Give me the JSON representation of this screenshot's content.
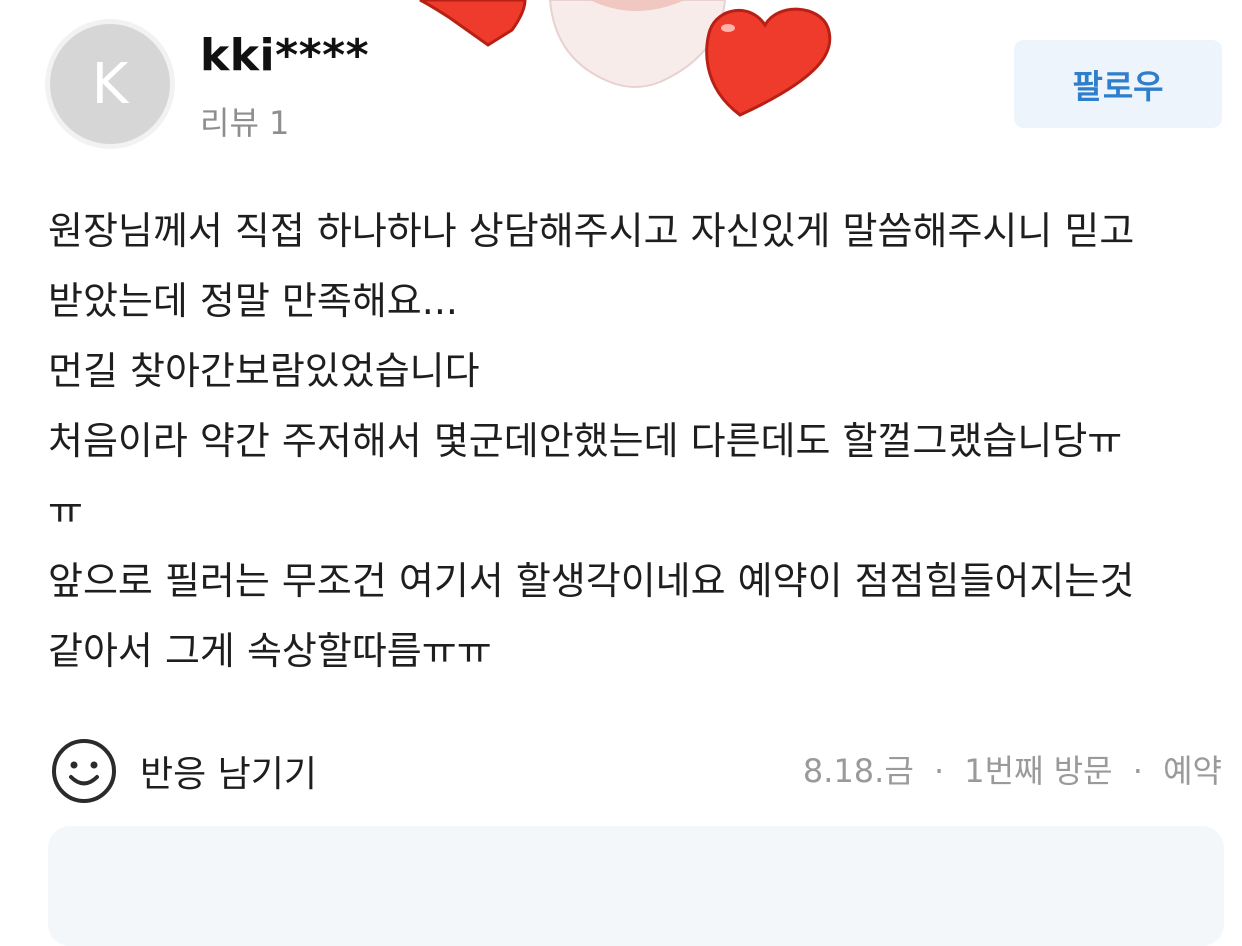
{
  "header": {
    "avatar_letter": "K",
    "username": "kki****",
    "review_count": "리뷰 1",
    "follow_label": "팔로우"
  },
  "review": {
    "lines": [
      "원장님께서 직접 하나하나 상담해주시고 자신있게 말씀해주시니 믿고",
      "받았는데 정말 만족해요...",
      "먼길 찾아간보람있었습니다",
      "처음이라 약간 주저해서 몇군데안했는데 다른데도 할껄그랬습니당ㅠ",
      "ㅠ",
      "앞으로 필러는 무조건 여기서 할생각이네요 예약이 점점힘들어지는것",
      "같아서 그게 속상할따름ㅠㅠ"
    ]
  },
  "footer": {
    "reaction_label": "반응 남기기",
    "date": "8.18.금",
    "visit": "1번째 방문",
    "type": "예약",
    "separator": "·"
  },
  "icons": {
    "reaction": "smiley-face-icon",
    "decor": "heart-icon"
  },
  "colors": {
    "follow_bg": "#edf4fb",
    "follow_text": "#2f7ecb",
    "heart": "#ee3b2b",
    "panel_bg": "#f3f7fa"
  }
}
